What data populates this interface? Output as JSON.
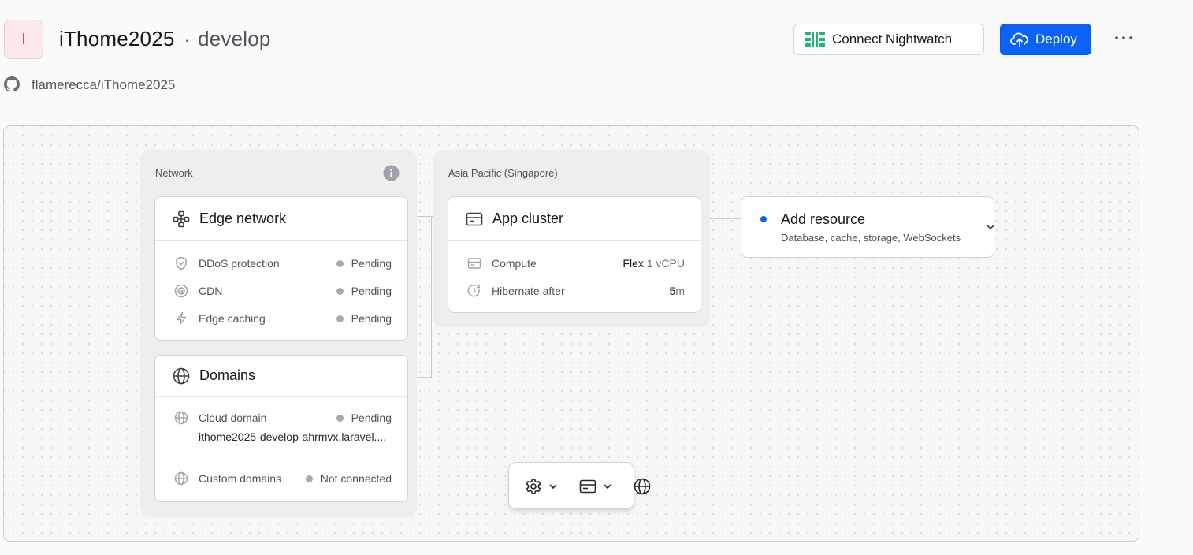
{
  "header": {
    "avatar_letter": "I",
    "project_name": "iThome2025",
    "separator": "·",
    "branch": "develop",
    "repo": "flamerecca/iThome2025",
    "nightwatch_label": "Connect Nightwatch",
    "deploy_label": "Deploy"
  },
  "colors": {
    "accent": "#0b63f6",
    "nightwatch": "#22b573",
    "pending_dot": "#a9a9b1",
    "avatar": "#e0405a"
  },
  "network_group": {
    "label": "Network",
    "edge_network": {
      "title": "Edge network",
      "rows": [
        {
          "icon": "shield-icon",
          "label": "DDoS protection",
          "status": "Pending"
        },
        {
          "icon": "cdn-icon",
          "label": "CDN",
          "status": "Pending"
        },
        {
          "icon": "lightning-icon",
          "label": "Edge caching",
          "status": "Pending"
        }
      ]
    },
    "domains": {
      "title": "Domains",
      "cloud_domain_label": "Cloud domain",
      "cloud_domain_status": "Pending",
      "cloud_domain_value": "ithome2025-develop-ahrmvx.laravel....",
      "custom_domains_label": "Custom domains",
      "custom_domains_status": "Not connected"
    }
  },
  "region_group": {
    "label": "Asia Pacific (Singapore)",
    "app_cluster": {
      "title": "App cluster",
      "compute_label": "Compute",
      "compute_value": "Flex",
      "compute_unit": "1 vCPU",
      "hibernate_label": "Hibernate after",
      "hibernate_value": "5",
      "hibernate_unit": "m"
    }
  },
  "add_resource": {
    "title": "Add resource",
    "subtitle": "Database, cache, storage, WebSockets"
  }
}
